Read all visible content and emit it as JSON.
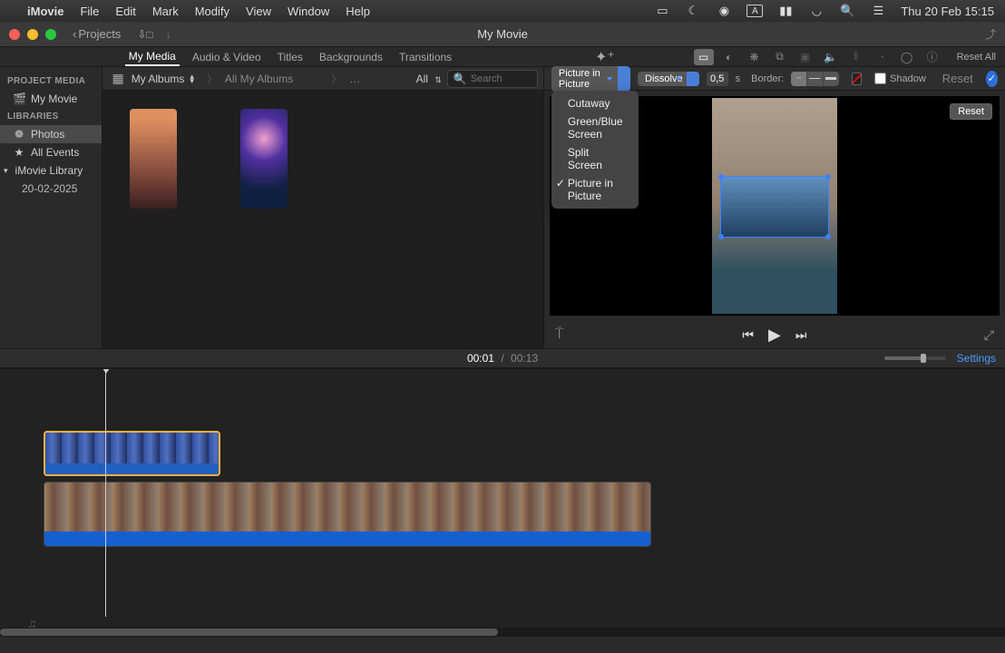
{
  "menubar": {
    "app": "iMovie",
    "items": [
      "File",
      "Edit",
      "Mark",
      "Modify",
      "View",
      "Window",
      "Help"
    ],
    "clock": "Thu 20 Feb  15:15"
  },
  "window": {
    "title": "My Movie",
    "projects": "Projects"
  },
  "tabs": {
    "left": [
      "My Media",
      "Audio & Video",
      "Titles",
      "Backgrounds",
      "Transitions"
    ],
    "active": "My Media",
    "reset_all": "Reset All"
  },
  "sidebar": {
    "project_media_heading": "PROJECT MEDIA",
    "project_item": "My Movie",
    "libraries_heading": "LIBRARIES",
    "photos": "Photos",
    "all_events": "All Events",
    "imovie_library": "iMovie Library",
    "event_date": "20-02-2025"
  },
  "browser": {
    "album_select": "My Albums",
    "breadcrumb": "All My Albums",
    "more": "…",
    "filter": "All",
    "search_placeholder": "Search"
  },
  "viewer_controls": {
    "overlay_mode": "Picture in Picture",
    "transition": "Dissolve",
    "duration": "0,5",
    "unit": "s",
    "border_label": "Border:",
    "shadow_label": "Shadow",
    "reset": "Reset"
  },
  "overlay_menu": {
    "items": [
      "Cutaway",
      "Green/Blue Screen",
      "Split Screen",
      "Picture in Picture"
    ],
    "selected": "Picture in Picture"
  },
  "preview": {
    "reset": "Reset"
  },
  "timeline_header": {
    "current": "00:01",
    "separator": "/",
    "duration": "00:13",
    "settings": "Settings"
  }
}
